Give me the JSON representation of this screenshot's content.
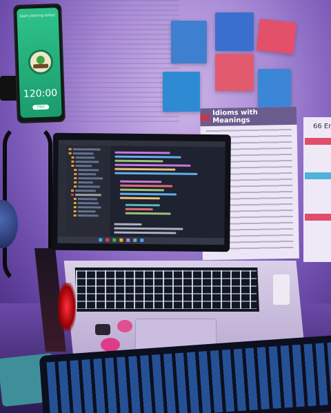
{
  "phone": {
    "timer": "120:00",
    "top_text": "Start planting today!",
    "button_label": "Plant"
  },
  "poster": {
    "title": "Idioms with Meanings"
  },
  "poster2": {
    "title": "66 En"
  },
  "colors": {
    "wall_purple": "#a98bd6",
    "sticky_blue": "#3f8fd0",
    "sticky_red": "#e25a6e",
    "keyboard_blue": "#3c8cff",
    "laptop_silver": "#d9d0e8"
  }
}
